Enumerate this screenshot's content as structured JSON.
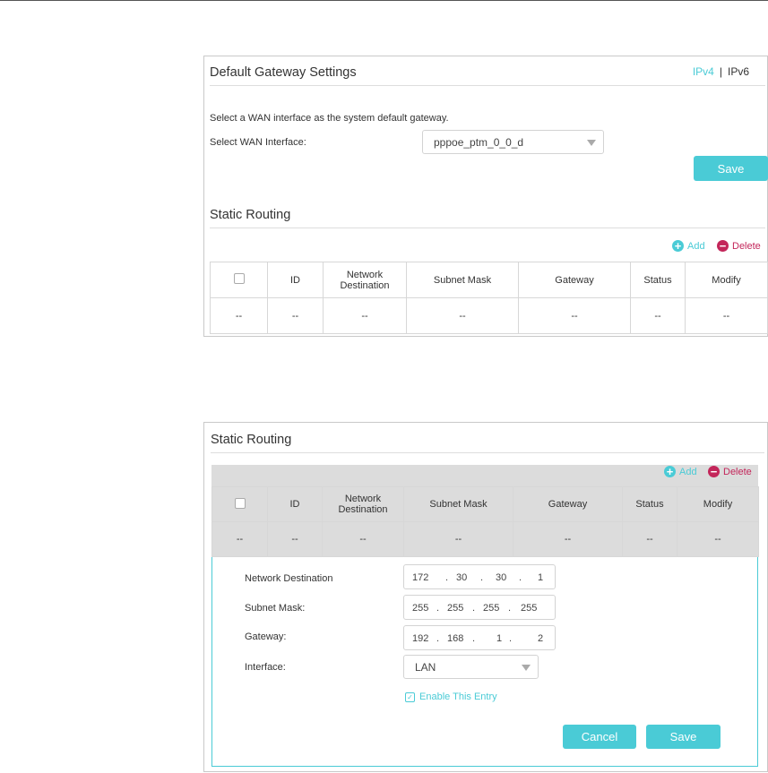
{
  "panel1": {
    "title": "Default Gateway Settings",
    "ip_tabs": {
      "ipv4": "IPv4",
      "separator": "|",
      "ipv6": "IPv6"
    },
    "instruction": "Select a WAN interface as the system default gateway.",
    "wan_label": "Select WAN Interface:",
    "wan_value": "pppoe_ptm_0_0_d",
    "save_label": "Save",
    "static_title": "Static Routing",
    "add_label": "Add",
    "delete_label": "Delete",
    "columns": {
      "id": "ID",
      "network_destination": "Network Destination",
      "subnet_mask": "Subnet Mask",
      "gateway": "Gateway",
      "status": "Status",
      "modify": "Modify"
    },
    "empty_cell": "--"
  },
  "panel2": {
    "static_title": "Static Routing",
    "add_label": "Add",
    "delete_label": "Delete",
    "columns": {
      "id": "ID",
      "network_destination": "Network Destination",
      "subnet_mask": "Subnet Mask",
      "gateway": "Gateway",
      "status": "Status",
      "modify": "Modify"
    },
    "empty_cell": "--",
    "form": {
      "network_destination_label": "Network Destination",
      "network_destination": [
        "172",
        "30",
        "30",
        "1"
      ],
      "subnet_mask_label": "Subnet Mask:",
      "subnet_mask": [
        "255",
        "255",
        "255",
        "255"
      ],
      "gateway_label": "Gateway:",
      "gateway": [
        "192",
        "168",
        "1",
        "2"
      ],
      "interface_label": "Interface:",
      "interface_value": "LAN",
      "enable_label": "Enable This Entry",
      "enable_checked": true,
      "ip_dot": ".",
      "cancel_label": "Cancel",
      "save_label": "Save"
    }
  },
  "colors": {
    "accent": "#4acbd6",
    "delete": "#c3265a"
  }
}
